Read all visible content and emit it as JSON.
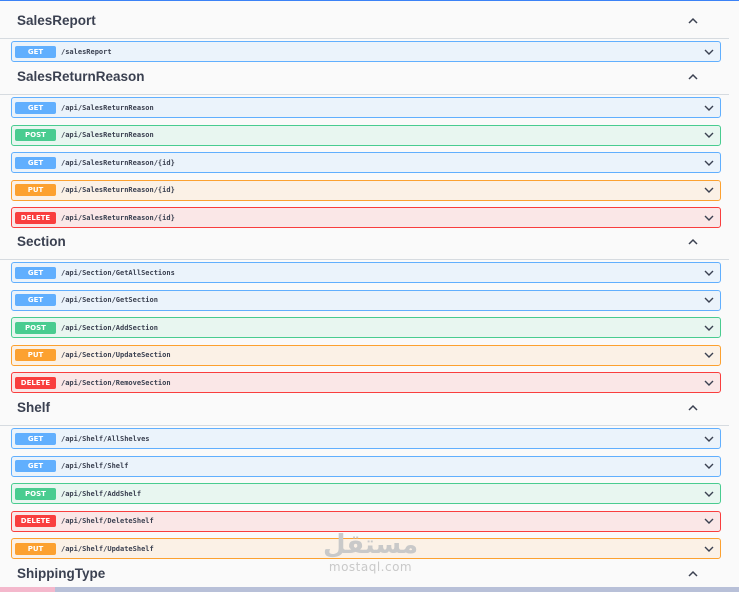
{
  "sections": [
    {
      "title": "SalesReport",
      "ops": [
        {
          "method": "GET",
          "path": "/salesReport",
          "kind": "get"
        }
      ]
    },
    {
      "title": "SalesReturnReason",
      "ops": [
        {
          "method": "GET",
          "path": "/api/SalesReturnReason",
          "kind": "get"
        },
        {
          "method": "POST",
          "path": "/api/SalesReturnReason",
          "kind": "post"
        },
        {
          "method": "GET",
          "path": "/api/SalesReturnReason/{id}",
          "kind": "get"
        },
        {
          "method": "PUT",
          "path": "/api/SalesReturnReason/{id}",
          "kind": "put"
        },
        {
          "method": "DELETE",
          "path": "/api/SalesReturnReason/{id}",
          "kind": "delete"
        }
      ]
    },
    {
      "title": "Section",
      "ops": [
        {
          "method": "GET",
          "path": "/api/Section/GetAllSections",
          "kind": "get"
        },
        {
          "method": "GET",
          "path": "/api/Section/GetSection",
          "kind": "get"
        },
        {
          "method": "POST",
          "path": "/api/Section/AddSection",
          "kind": "post"
        },
        {
          "method": "PUT",
          "path": "/api/Section/UpdateSection",
          "kind": "put"
        },
        {
          "method": "DELETE",
          "path": "/api/Section/RemoveSection",
          "kind": "delete"
        }
      ]
    },
    {
      "title": "Shelf",
      "ops": [
        {
          "method": "GET",
          "path": "/api/Shelf/AllShelves",
          "kind": "get"
        },
        {
          "method": "GET",
          "path": "/api/Shelf/Shelf",
          "kind": "get"
        },
        {
          "method": "POST",
          "path": "/api/Shelf/AddShelf",
          "kind": "post"
        },
        {
          "method": "DELETE",
          "path": "/api/Shelf/DeleteShelf",
          "kind": "delete"
        },
        {
          "method": "PUT",
          "path": "/api/Shelf/UpdateShelf",
          "kind": "put"
        }
      ]
    },
    {
      "title": "ShippingType",
      "ops": []
    }
  ],
  "watermark": {
    "arabic": "مستقل",
    "latin": "mostaql.com"
  },
  "icons": {
    "section_toggle": "chevron-up-icon",
    "op_expand": "chevron-down-icon"
  },
  "colors": {
    "get": "#61affe",
    "post": "#49cc90",
    "put": "#fca130",
    "delete": "#f93e3e"
  }
}
